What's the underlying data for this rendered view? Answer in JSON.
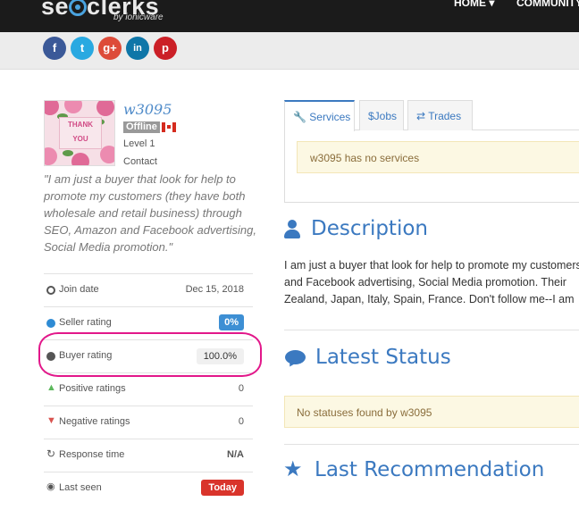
{
  "header": {
    "logo_text": "seoclerks",
    "logo_sub": "by ionicware",
    "nav": [
      "HOME",
      "COMMUNITY"
    ]
  },
  "social": [
    {
      "name": "facebook",
      "glyph": "f"
    },
    {
      "name": "twitter",
      "glyph": "t"
    },
    {
      "name": "google-plus",
      "glyph": "g+"
    },
    {
      "name": "linkedin",
      "glyph": "in"
    },
    {
      "name": "pinterest",
      "glyph": "p"
    }
  ],
  "profile": {
    "username": "w3095",
    "status": "Offline",
    "level": "Level 1",
    "contact": "Contact",
    "avatar_text": [
      "THANK",
      "YOU"
    ],
    "quote": "\"I am just a buyer that look for help to promote my customers (they have both wholesale and retail business) through SEO, Amazon and Facebook advertising, Social Media promotion.\""
  },
  "stats": [
    {
      "label": "Join date",
      "value": "Dec 15, 2018",
      "icon": "plus-circle-icon"
    },
    {
      "label": "Seller rating",
      "value": "0%",
      "icon": "blue-dot-icon"
    },
    {
      "label": "Buyer rating",
      "value": "100.0%",
      "icon": "gray-dot-icon"
    },
    {
      "label": "Positive ratings",
      "value": "0",
      "icon": "thumbs-up-icon"
    },
    {
      "label": "Negative ratings",
      "value": "0",
      "icon": "thumbs-down-icon"
    },
    {
      "label": "Response time",
      "value": "N/A",
      "icon": "refresh-icon"
    },
    {
      "label": "Last seen",
      "value": "Today",
      "icon": "eye-icon"
    }
  ],
  "tabs": [
    {
      "label": "Services",
      "icon": "wrench-icon"
    },
    {
      "label": "$Jobs",
      "icon": ""
    },
    {
      "label": "Trades",
      "icon": "exchange-icon"
    }
  ],
  "services_alert": "w3095 has no services",
  "description": {
    "title": "Description",
    "lines": [
      "I am just a buyer that look for help to promote my customers",
      "and Facebook advertising, Social Media promotion. Their",
      "Zealand, Japan, Italy, Spain, France. Don't follow me--I am"
    ]
  },
  "latest_status": {
    "title": "Latest Status",
    "alert": "No statuses found by w3095"
  },
  "recommendation": {
    "title": "Last Recommendation"
  },
  "colors": {
    "accent": "#3b79c0",
    "highlight": "#e2178a",
    "alert_bg": "#fcf8e3"
  }
}
